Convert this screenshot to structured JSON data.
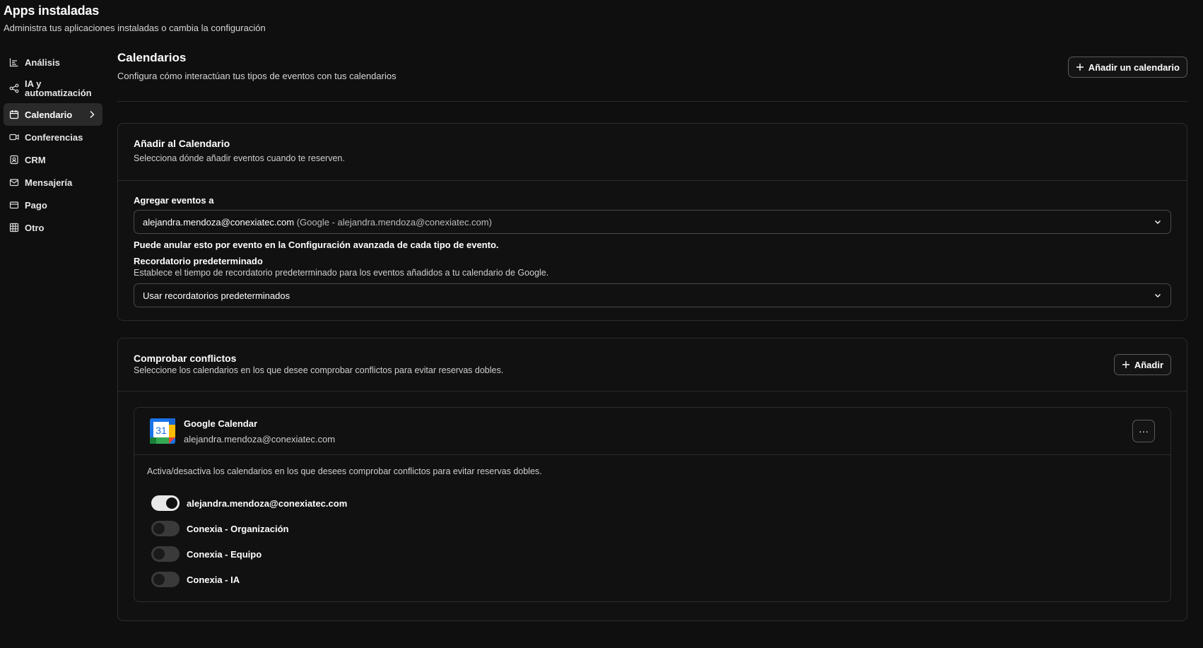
{
  "header": {
    "title": "Apps instaladas",
    "subtitle": "Administra tus aplicaciones instaladas o cambia la configuración"
  },
  "sidebar": {
    "items": [
      {
        "label": "Análisis",
        "icon": "chart-icon"
      },
      {
        "label": "IA y automatización",
        "icon": "share-icon"
      },
      {
        "label": "Calendario",
        "icon": "calendar-icon",
        "active": true
      },
      {
        "label": "Conferencias",
        "icon": "video-icon"
      },
      {
        "label": "CRM",
        "icon": "contact-icon"
      },
      {
        "label": "Mensajería",
        "icon": "mail-icon"
      },
      {
        "label": "Pago",
        "icon": "credit-card-icon"
      },
      {
        "label": "Otro",
        "icon": "grid-icon"
      }
    ]
  },
  "section": {
    "title": "Calendarios",
    "description": "Configura cómo interactúan tus tipos de eventos con tus calendarios",
    "add_button": "Añadir un calendario"
  },
  "add_card": {
    "title": "Añadir al Calendario",
    "description": "Selecciona dónde añadir eventos cuando te reserven.",
    "field_label": "Agregar eventos a",
    "selected_email": "alejandra.mendoza@conexiatec.com",
    "selected_detail": "(Google - alejandra.mendoza@conexiatec.com)",
    "override_note": "Puede anular esto por evento en la Configuración avanzada de cada tipo de evento.",
    "reminder_label": "Recordatorio predeterminado",
    "reminder_desc": "Establece el tiempo de recordatorio predeterminado para los eventos añadidos a tu calendario de Google.",
    "reminder_value": "Usar recordatorios predeterminados"
  },
  "conflicts_card": {
    "title": "Comprobar conflictos",
    "description": "Seleccione los calendarios en los que desee comprobar conflictos para evitar reservas dobles.",
    "add_button": "Añadir",
    "provider": {
      "name": "Google Calendar",
      "email": "alejandra.mendoza@conexiatec.com",
      "logo_day": "31",
      "more": "···"
    },
    "instructions": "Activa/desactiva los calendarios en los que desees comprobar conflictos para evitar reservas dobles.",
    "calendars": [
      {
        "label": "alejandra.mendoza@conexiatec.com",
        "enabled": true
      },
      {
        "label": "Conexia - Organización",
        "enabled": false
      },
      {
        "label": "Conexia - Equipo",
        "enabled": false
      },
      {
        "label": "Conexia - IA",
        "enabled": false
      }
    ]
  }
}
